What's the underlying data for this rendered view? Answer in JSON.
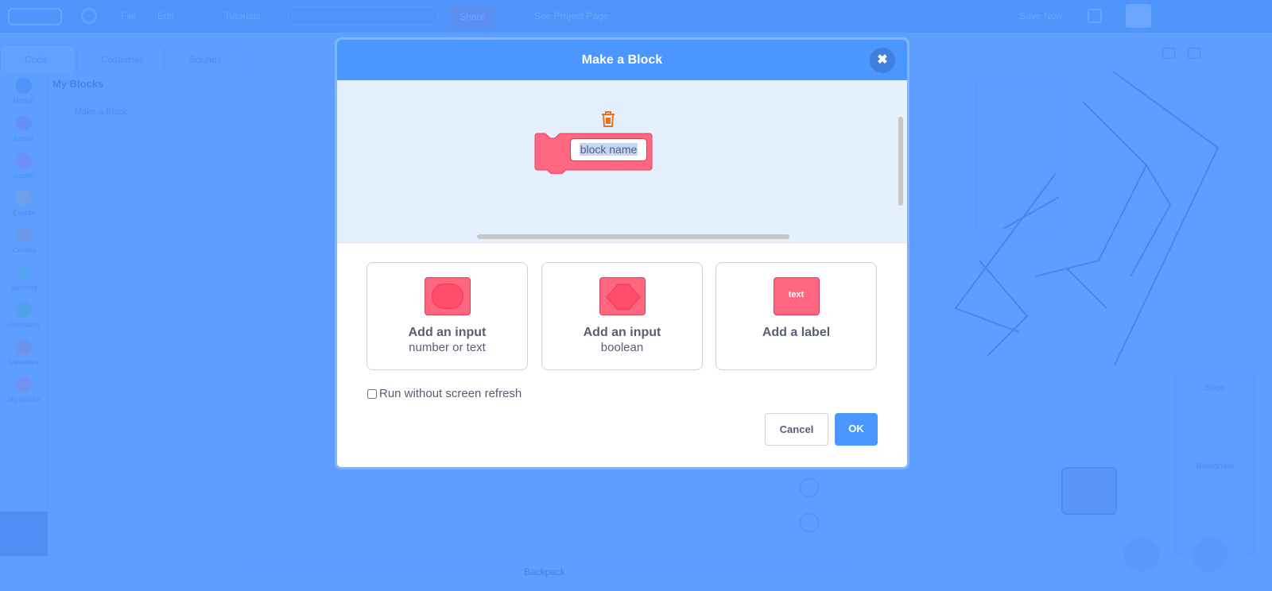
{
  "menubar": {
    "items": [
      "File",
      "Edit",
      "Tutorials"
    ],
    "share": "Share",
    "see_project_page": "See Project Page",
    "save_now": "Save Now"
  },
  "tabs": [
    "Code",
    "Costumes",
    "Sounds"
  ],
  "categories": [
    "Motion",
    "Looks",
    "Sound",
    "Events",
    "Control",
    "Sensing",
    "Operators",
    "Variables",
    "My Blocks"
  ],
  "category_colors": [
    "#4c97ff",
    "#9966ff",
    "#cf63cf",
    "#ffbf00",
    "#ffab19",
    "#5cb1d6",
    "#59c059",
    "#ff8c1a",
    "#ff6680"
  ],
  "palette": {
    "title": "My Blocks",
    "make_block": "Make a Block"
  },
  "backpack": "Backpack",
  "stage_panel": {
    "title": "Stage",
    "backdrops": "Backdrops"
  },
  "dialog": {
    "title": "Make a Block",
    "block_name": "block name",
    "options": [
      {
        "title": "Add an input",
        "subtitle": "number or text",
        "icon": "round-input-icon"
      },
      {
        "title": "Add an input",
        "subtitle": "boolean",
        "icon": "boolean-input-icon"
      },
      {
        "title": "Add a label",
        "subtitle": "",
        "icon": "label-text-icon",
        "icon_text": "text"
      }
    ],
    "run_without_refresh": "Run without screen refresh",
    "run_without_refresh_checked": false,
    "cancel": "Cancel",
    "ok": "OK",
    "block_color": "#ff6680",
    "accent": "#4c97ff"
  }
}
